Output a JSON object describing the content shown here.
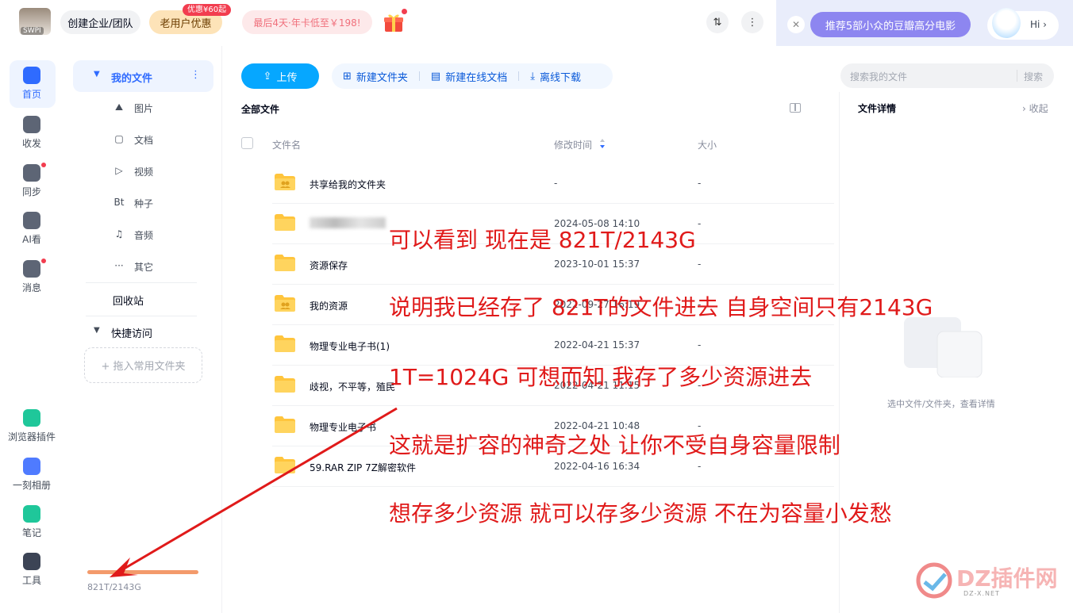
{
  "header": {
    "avatar_tag": "SWPI",
    "team_btn": "创建企业/团队",
    "old_user_btn": "老用户优惠",
    "old_user_badge": "优惠¥60起",
    "promo_btn": "最后4天·年卡低至￥198!",
    "sort_icon_label": "⇅",
    "more_icon_label": "⋮",
    "close_label": "✕",
    "recommend_btn": "推荐5部小众的豆瓣高分电影",
    "hi_label": "Hi ›"
  },
  "rail": [
    {
      "label": "首页",
      "icon": "home-icon",
      "color": "#2f6bff"
    },
    {
      "label": "收发",
      "icon": "share-icon",
      "color": "#5d6575"
    },
    {
      "label": "同步",
      "icon": "sync-icon",
      "color": "#5d6575"
    },
    {
      "label": "AI看",
      "icon": "ai-icon",
      "color": "#5d6575"
    },
    {
      "label": "消息",
      "icon": "message-icon",
      "color": "#5d6575"
    },
    {
      "label": "浏览器插件",
      "icon": "plugin-icon",
      "color": "#1fc79a"
    },
    {
      "label": "一刻相册",
      "icon": "album-icon",
      "color": "#4f7bff"
    },
    {
      "label": "笔记",
      "icon": "note-icon",
      "color": "#1fc79a"
    },
    {
      "label": "工具",
      "icon": "tools-icon",
      "color": "#3c4455"
    }
  ],
  "nav": {
    "my_files": "我的文件",
    "items": [
      {
        "label": "图片",
        "glyph": "⛰"
      },
      {
        "label": "文档",
        "glyph": "▢"
      },
      {
        "label": "视频",
        "glyph": "▷"
      },
      {
        "label": "种子",
        "glyph": "Bt"
      },
      {
        "label": "音频",
        "glyph": "♫"
      },
      {
        "label": "其它",
        "glyph": "···"
      }
    ],
    "recycle": "回收站",
    "quick_access": "快捷访问",
    "drop_hint": "+ 拖入常用文件夹",
    "quota_text": "821T/2143G",
    "quota_used": 1.0
  },
  "toolbar": {
    "upload": "上传",
    "new_folder": "新建文件夹",
    "new_online_doc": "新建在线文档",
    "offline_download": "离线下载",
    "search_placeholder": "搜索我的文件",
    "search_btn": "搜索"
  },
  "breadcrumb": "全部文件",
  "table": {
    "col_name": "文件名",
    "col_time": "修改时间",
    "col_size": "大小",
    "rows": [
      {
        "name": "共享给我的文件夹",
        "time": "-",
        "size": "-",
        "shared": true
      },
      {
        "name": "",
        "time": "2024-05-08 14:10",
        "size": "-",
        "shared": false,
        "blurred": true
      },
      {
        "name": "资源保存",
        "time": "2023-10-01 15:37",
        "size": "-",
        "shared": false
      },
      {
        "name": "我的资源",
        "time": "2022-09-27 16:19",
        "size": "-",
        "shared": true
      },
      {
        "name": "物理专业电子书(1)",
        "time": "2022-04-21 15:37",
        "size": "-",
        "shared": false
      },
      {
        "name": "歧视，不平等，殖民",
        "time": "2022-04-21 11:15",
        "size": "-",
        "shared": false
      },
      {
        "name": "物理专业电子书",
        "time": "2022-04-21 10:48",
        "size": "-",
        "shared": false
      },
      {
        "name": "59.RAR ZIP 7Z解密软件",
        "time": "2022-04-16 16:34",
        "size": "-",
        "shared": false
      }
    ]
  },
  "detail": {
    "title": "文件详情",
    "collapse": "›  收起",
    "empty_hint": "选中文件/文件夹，查看详情"
  },
  "annotations": [
    "可以看到 现在是 821T/2143G",
    "说明我已经存了 821T的文件进去  自身空间只有2143G",
    "1T=1024G  可想而知 我存了多少资源进去",
    "这就是扩容的神奇之处 让你不受自身容量限制",
    "想存多少资源  就可以存多少资源  不在为容量小发愁"
  ],
  "watermark": {
    "text": "DZ插件网",
    "sub": "DZ-X.NET"
  },
  "colors": {
    "accent": "#06a7ff",
    "annotation": "#e01a1a",
    "folder": "#ffc53d"
  }
}
